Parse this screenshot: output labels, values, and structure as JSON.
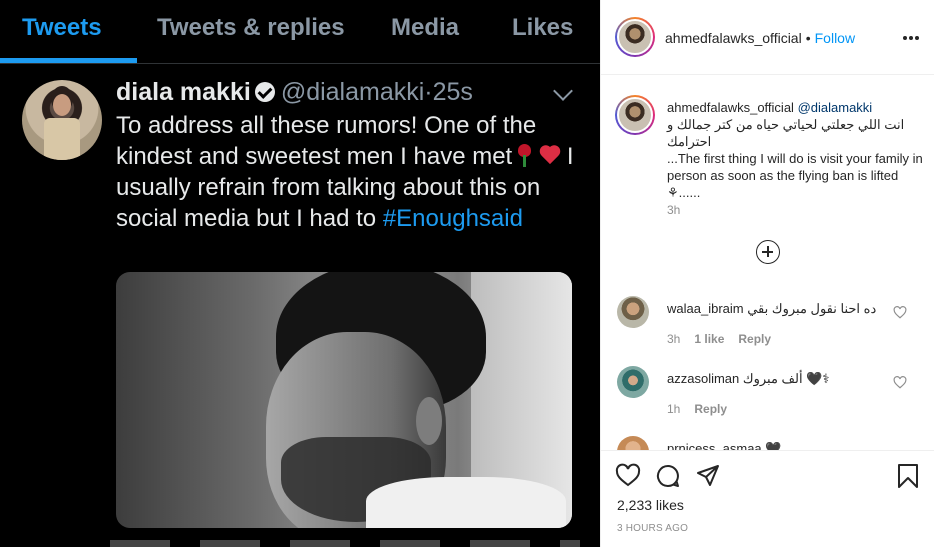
{
  "tweet": {
    "tabs": [
      "Tweets",
      "Tweets & replies",
      "Media",
      "Likes"
    ],
    "author_name": "diala makki",
    "handle": "@dialamakki",
    "separator": "·",
    "time": "25s",
    "text_part1": "To address all these rumors! One of the kindest and sweetest men I have met",
    "text_part2": "I usually refrain from talking about this on social media but I had to",
    "hashtag": "#Enoughsaid",
    "accent_color": "#1d9bf0"
  },
  "post": {
    "username": "ahmedfalawks_official",
    "separator": "•",
    "follow_label": "Follow",
    "caption": {
      "username": "ahmedfalawks_official",
      "mention": "@dialamakki",
      "arabic_line": "انت اللي جعلتي لحياتي حياه من كتر جمالك و احترامك",
      "english_text": "...The first thing I will do is visit your family in person as soon as the flying ban is lifted",
      "trailing": "......",
      "time": "3h"
    },
    "comments": [
      {
        "username": "walaa_ibraim",
        "text": "ده احنا نقول مبروك بقي",
        "time": "3h",
        "likes": "1 like",
        "reply": "Reply"
      },
      {
        "username": "azzasoliman",
        "text": "ألف مبروك",
        "time": "1h",
        "likes": "",
        "reply": "Reply"
      },
      {
        "username": "prnicess_asmaa",
        "text": "",
        "time": "",
        "likes": "",
        "reply": ""
      }
    ],
    "likes_count": "2,233 likes",
    "posted_ago": "3 HOURS AGO",
    "icons": [
      "heart-icon",
      "comment-icon",
      "share-icon",
      "bookmark-icon",
      "more-options-icon",
      "add-circle-icon"
    ]
  }
}
